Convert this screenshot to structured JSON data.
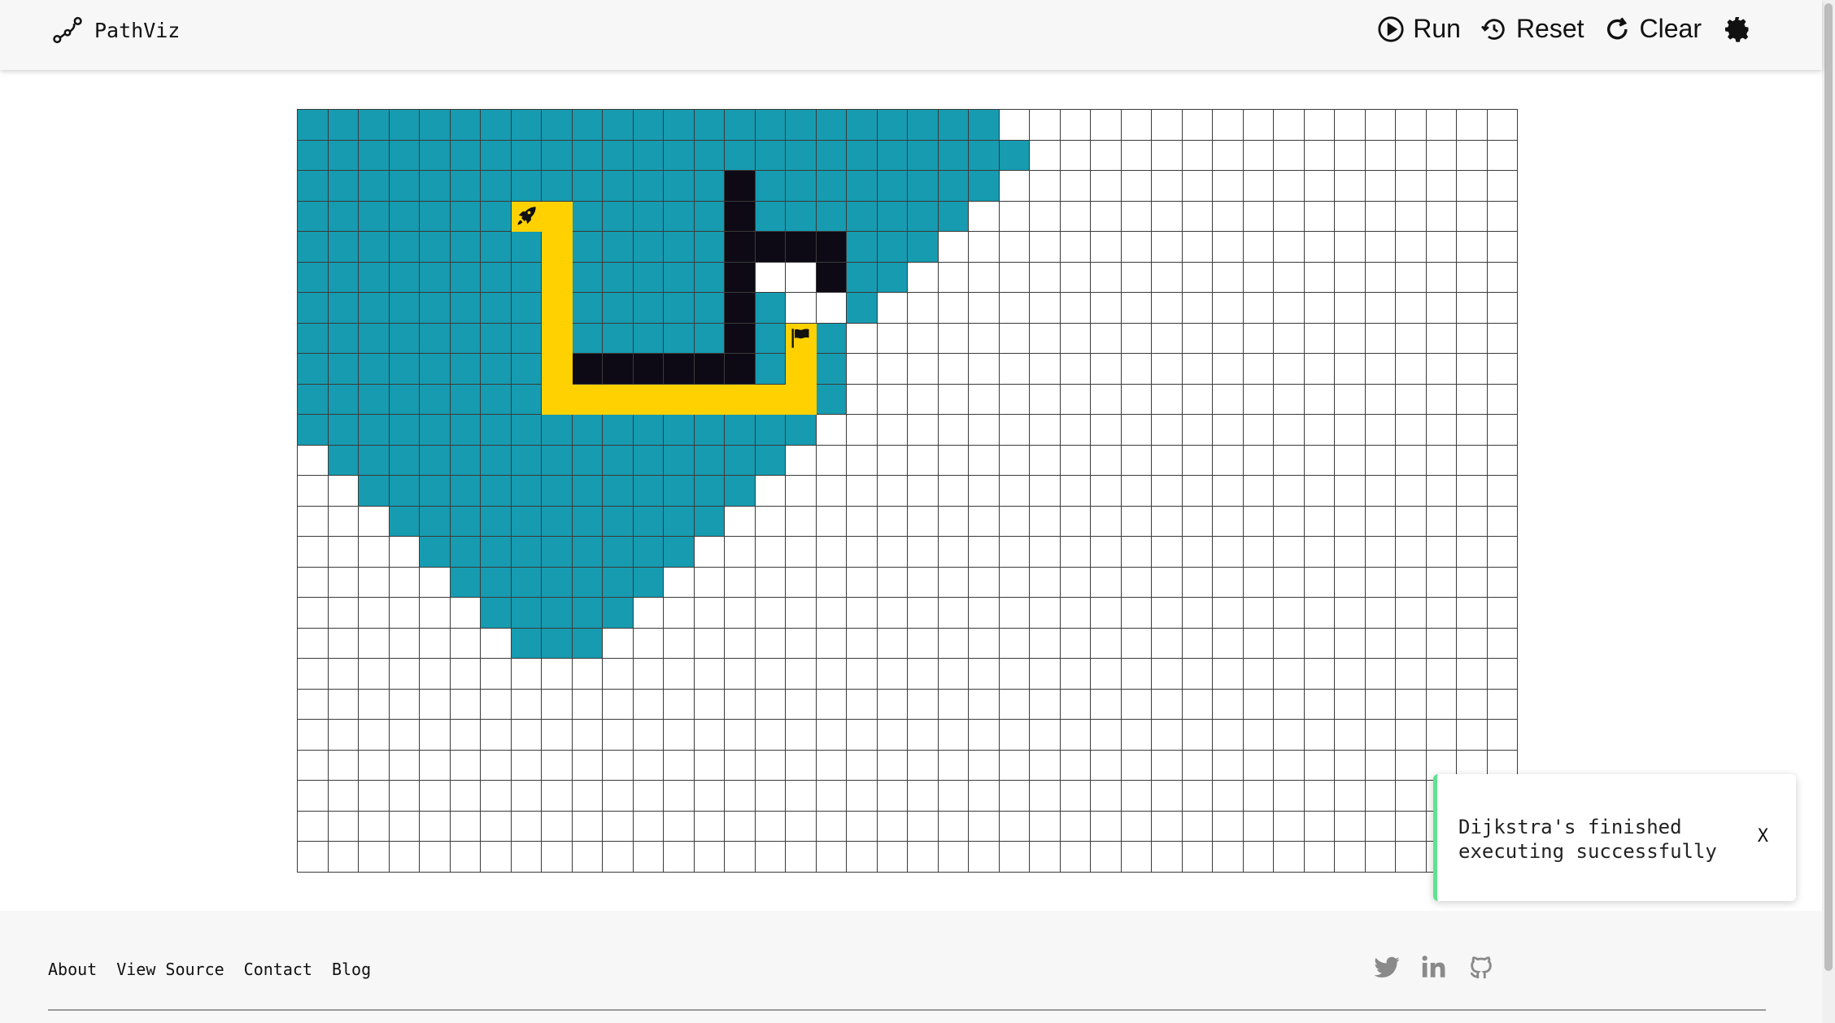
{
  "app": {
    "name": "PathViz"
  },
  "toolbar": {
    "run": "Run",
    "reset": "Reset",
    "clear": "Clear"
  },
  "icons": {
    "logo": "graph-path-icon",
    "run": "play-circle-icon",
    "reset": "history-icon",
    "clear": "redo-icon",
    "settings": "gear-icon",
    "start": "rocket-icon",
    "target": "flag-icon",
    "social": [
      "twitter-icon",
      "linkedin-icon",
      "github-icon"
    ]
  },
  "grid": {
    "cols": 40,
    "rows": 25,
    "start": [
      7,
      3
    ],
    "target": [
      16,
      7
    ],
    "visited_rows": [
      [
        0,
        22
      ],
      [
        0,
        23
      ],
      [
        0,
        22
      ],
      [
        0,
        21
      ],
      [
        0,
        20
      ],
      [
        0,
        19
      ],
      [
        0,
        18
      ],
      [
        0,
        17
      ],
      [
        0,
        17
      ],
      [
        0,
        17
      ],
      [
        0,
        16
      ],
      [
        1,
        15
      ],
      [
        2,
        14
      ],
      [
        3,
        13
      ],
      [
        4,
        12
      ],
      [
        5,
        11
      ],
      [
        6,
        10
      ],
      [
        7,
        9
      ]
    ],
    "unvisited_cells": [
      [
        15,
        5
      ],
      [
        16,
        5
      ],
      [
        16,
        6
      ],
      [
        17,
        6
      ]
    ],
    "extra_visited_cells": [
      [
        17,
        9
      ]
    ],
    "walls": [
      [
        14,
        2
      ],
      [
        14,
        3
      ],
      [
        14,
        4
      ],
      [
        15,
        4
      ],
      [
        16,
        4
      ],
      [
        17,
        4
      ],
      [
        14,
        5
      ],
      [
        17,
        5
      ],
      [
        14,
        6
      ],
      [
        14,
        7
      ],
      [
        9,
        8
      ],
      [
        10,
        8
      ],
      [
        11,
        8
      ],
      [
        12,
        8
      ],
      [
        13,
        8
      ],
      [
        14,
        8
      ]
    ],
    "path": [
      [
        8,
        3
      ],
      [
        8,
        4
      ],
      [
        8,
        5
      ],
      [
        8,
        6
      ],
      [
        8,
        7
      ],
      [
        8,
        8
      ],
      [
        8,
        9
      ],
      [
        9,
        9
      ],
      [
        10,
        9
      ],
      [
        11,
        9
      ],
      [
        12,
        9
      ],
      [
        13,
        9
      ],
      [
        14,
        9
      ],
      [
        15,
        9
      ],
      [
        16,
        9
      ],
      [
        16,
        8
      ],
      [
        16,
        7
      ]
    ],
    "colors": {
      "visited": "#169bb0",
      "wall": "#0d0a16",
      "path": "#ffd100",
      "empty": "#ffffff",
      "line": "#3a3a3a"
    }
  },
  "toast": {
    "message": "Dijkstra's finished executing successfully",
    "close": "X",
    "accent": "#5ee38f"
  },
  "footer": {
    "links": [
      "About",
      "View Source",
      "Contact",
      "Blog"
    ]
  }
}
